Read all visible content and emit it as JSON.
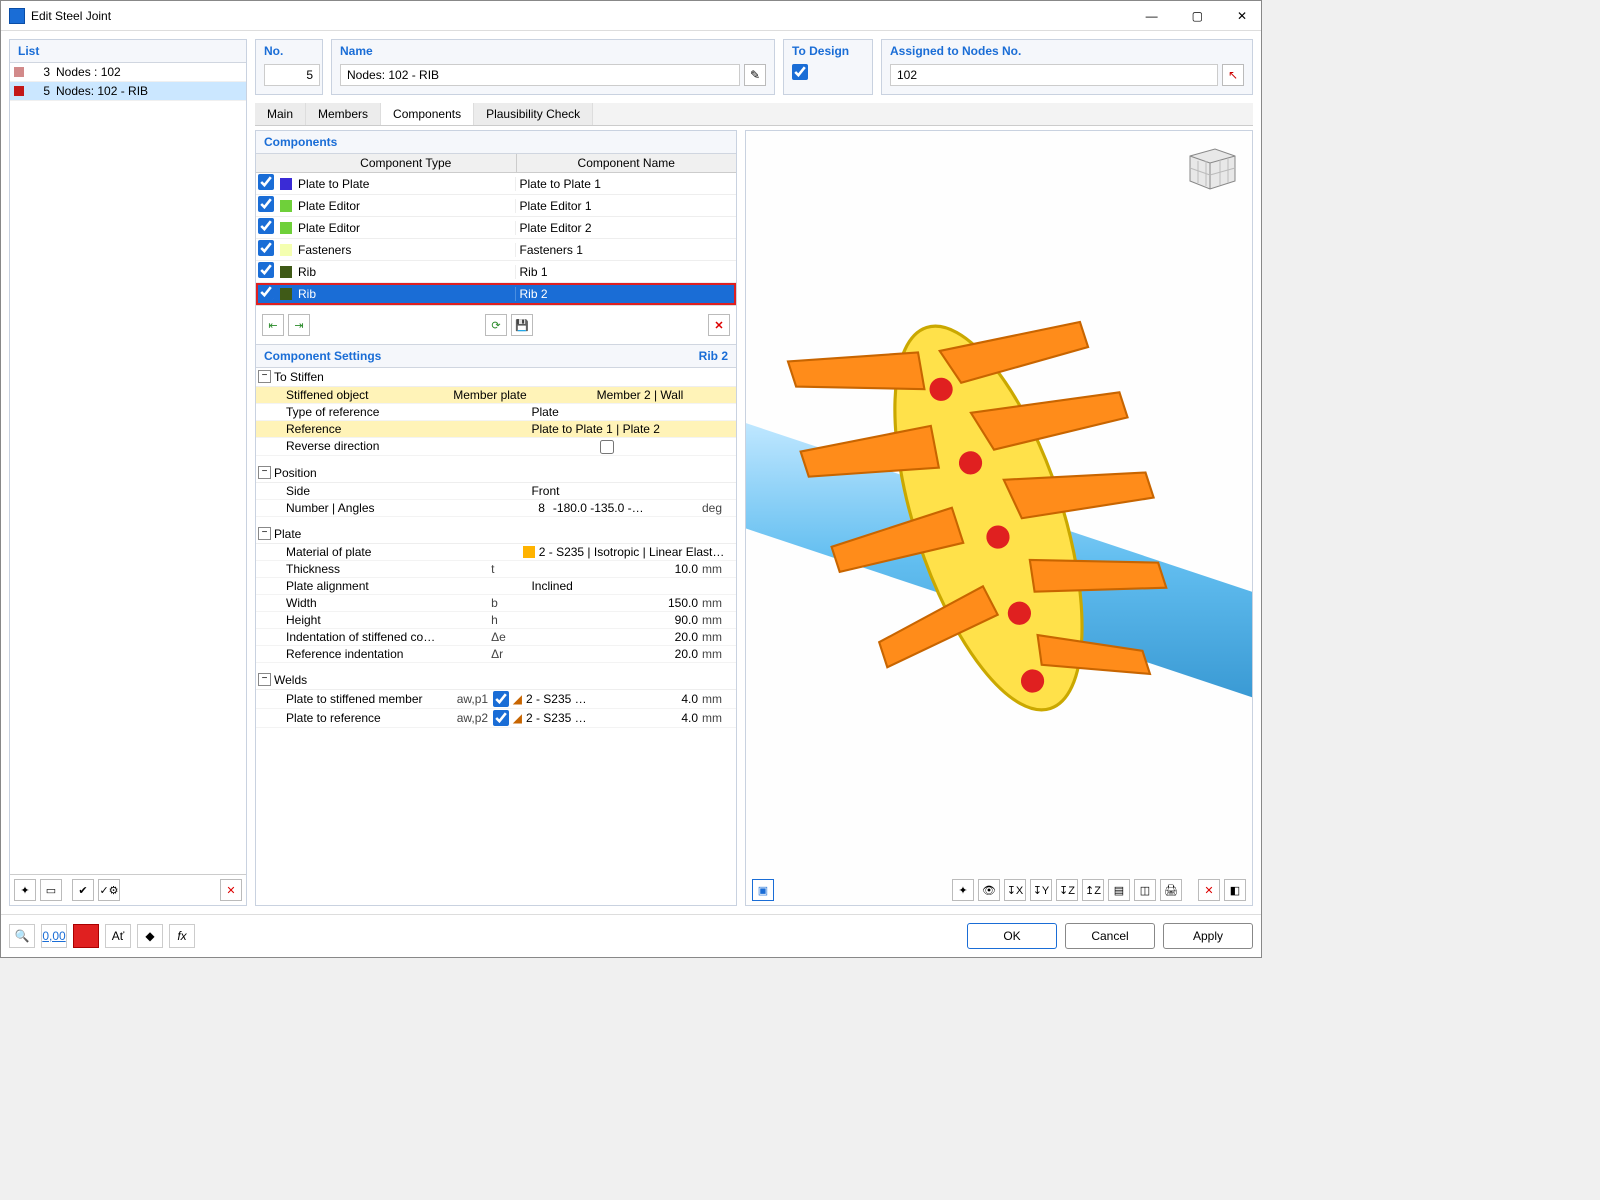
{
  "window": {
    "title": "Edit Steel Joint"
  },
  "left": {
    "header": "List",
    "items": [
      {
        "num": "3",
        "label": "Nodes : 102",
        "color": "#d28a8a",
        "selected": false
      },
      {
        "num": "5",
        "label": "Nodes: 102 - RIB",
        "color": "#c31818",
        "selected": true
      }
    ]
  },
  "top": {
    "no_label": "No.",
    "no_value": "5",
    "name_label": "Name",
    "name_value": "Nodes: 102 - RIB",
    "to_design_label": "To Design",
    "assigned_label": "Assigned to Nodes No.",
    "assigned_value": "102"
  },
  "tabs": [
    "Main",
    "Members",
    "Components",
    "Plausibility Check"
  ],
  "active_tab": "Components",
  "components": {
    "title": "Components",
    "headers": {
      "type": "Component Type",
      "name": "Component Name"
    },
    "rows": [
      {
        "checked": true,
        "color": "#3a2bd6",
        "type": "Plate to Plate",
        "name": "Plate to Plate 1"
      },
      {
        "checked": true,
        "color": "#6fd03a",
        "type": "Plate Editor",
        "name": "Plate Editor 1"
      },
      {
        "checked": true,
        "color": "#6fd03a",
        "type": "Plate Editor",
        "name": "Plate Editor 2"
      },
      {
        "checked": true,
        "color": "#f4ffb0",
        "type": "Fasteners",
        "name": "Fasteners 1"
      },
      {
        "checked": true,
        "color": "#3f5a17",
        "type": "Rib",
        "name": "Rib 1"
      },
      {
        "checked": true,
        "color": "#3f5a17",
        "type": "Rib",
        "name": "Rib 2",
        "selected": true
      }
    ]
  },
  "settings": {
    "header": "Component Settings",
    "header_right": "Rib 2",
    "groups": [
      {
        "title": "To Stiffen",
        "rows": [
          {
            "k": "Stiffened object",
            "v": "Member plate",
            "v2": "Member 2 | Wall",
            "hl": true
          },
          {
            "k": "Type of reference",
            "v": "Plate"
          },
          {
            "k": "Reference",
            "v": "Plate to Plate 1 | Plate  2",
            "hl": true
          },
          {
            "k": "Reverse direction",
            "v_checkbox": false
          }
        ]
      },
      {
        "title": "Position",
        "rows": [
          {
            "k": "Side",
            "v": "Front"
          },
          {
            "k": "Number | Angles",
            "sym": "",
            "vnum": "8",
            "v2": "-180.0 -135.0 -…",
            "u": "deg"
          }
        ]
      },
      {
        "title": "Plate",
        "rows": [
          {
            "k": "Material of plate",
            "color": "#ffb300",
            "v": "2 - S235 | Isotropic | Linear Elast…"
          },
          {
            "k": "Thickness",
            "sym": "t",
            "vnum": "10.0",
            "u": "mm"
          },
          {
            "k": "Plate alignment",
            "v": "Inclined"
          },
          {
            "k": "Width",
            "sym": "b",
            "vnum": "150.0",
            "u": "mm"
          },
          {
            "k": "Height",
            "sym": "h",
            "vnum": "90.0",
            "u": "mm"
          },
          {
            "k": "Indentation of stiffened co…",
            "sym": "Δe",
            "vnum": "20.0",
            "u": "mm"
          },
          {
            "k": "Reference indentation",
            "sym": "Δr",
            "vnum": "20.0",
            "u": "mm"
          }
        ]
      },
      {
        "title": "Welds",
        "rows": [
          {
            "k": "Plate to stiffened member",
            "sym": "aw,p1",
            "chk": true,
            "mat": "2 - S235 …",
            "vnum": "4.0",
            "u": "mm"
          },
          {
            "k": "Plate to reference",
            "sym": "aw,p2",
            "chk": true,
            "mat": "2 - S235 …",
            "vnum": "4.0",
            "u": "mm"
          }
        ]
      }
    ]
  },
  "footer": {
    "ok": "OK",
    "cancel": "Cancel",
    "apply": "Apply"
  }
}
